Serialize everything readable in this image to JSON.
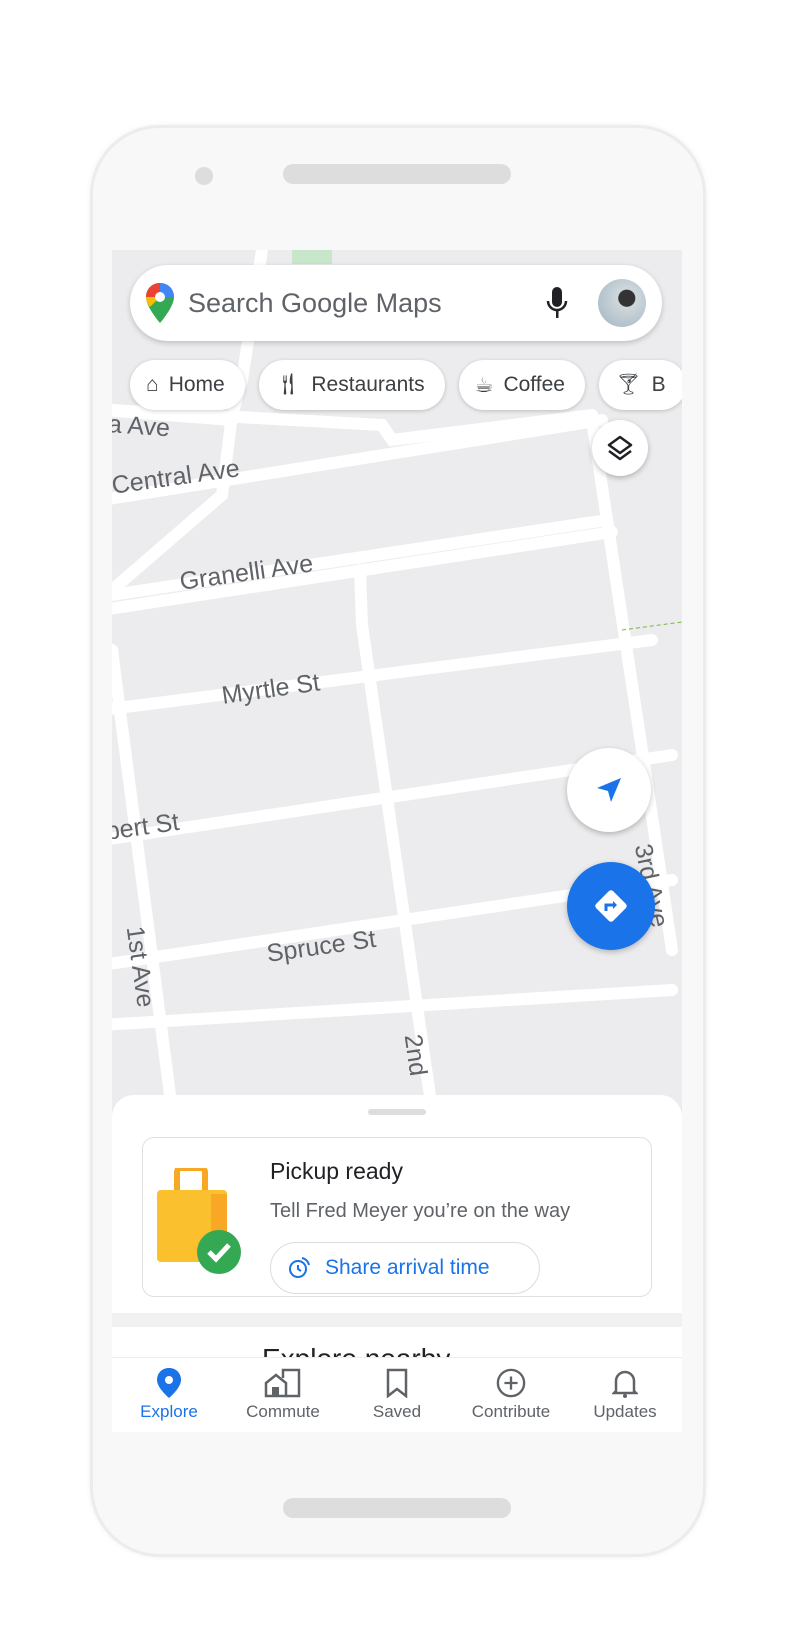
{
  "search": {
    "placeholder": "Search Google Maps"
  },
  "chips": [
    {
      "label": "Home",
      "icon": "home-icon"
    },
    {
      "label": "Restaurants",
      "icon": "fork-knife-icon"
    },
    {
      "label": "Coffee",
      "icon": "coffee-icon"
    },
    {
      "label": "B",
      "icon": "cocktail-icon"
    }
  ],
  "map_labels": {
    "a_ave": "a Ave",
    "central": "Central Ave",
    "granelli": "Granelli Ave",
    "myrtle": "Myrtle St",
    "bert": "pert St",
    "spruce": "Spruce St",
    "first": "1st Ave",
    "second": "2nd",
    "third": "3rd Ave"
  },
  "card": {
    "title": "Pickup ready",
    "subtitle": "Tell Fred Meyer you’re on the way",
    "button": "Share arrival time"
  },
  "explore_nearby": "Explore nearby",
  "nav": [
    {
      "label": "Explore",
      "active": true
    },
    {
      "label": "Commute"
    },
    {
      "label": "Saved"
    },
    {
      "label": "Contribute"
    },
    {
      "label": "Updates"
    }
  ],
  "colors": {
    "accent": "#1a73e8",
    "success": "#34a853",
    "bag": "#fbc02d"
  }
}
